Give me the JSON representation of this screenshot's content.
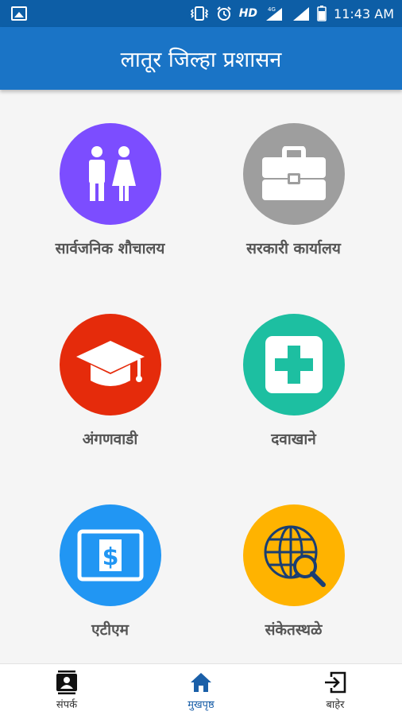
{
  "status_bar": {
    "network_type": "HD",
    "network_gen": "4G",
    "time": "11:43 AM"
  },
  "app_bar": {
    "title": "लातूर जिल्हा प्रशासन"
  },
  "tiles": [
    {
      "label": "सार्वजनिक शौचालय",
      "icon": "restroom-icon",
      "color": "#7c4dff"
    },
    {
      "label": "सरकारी कार्यालय",
      "icon": "briefcase-icon",
      "color": "#9e9e9e"
    },
    {
      "label": "अंगणवाडी",
      "icon": "graduation-cap-icon",
      "color": "#e52b0b"
    },
    {
      "label": "दवाखाने",
      "icon": "medical-cross-icon",
      "color": "#1dbfa1"
    },
    {
      "label": "एटीएम",
      "icon": "atm-icon",
      "color": "#2196f3"
    },
    {
      "label": "संकेतस्थळे",
      "icon": "web-search-icon",
      "color": "#ffb300"
    }
  ],
  "bottom_nav": {
    "items": [
      {
        "label": "संपर्क",
        "icon": "contacts-icon",
        "active": false
      },
      {
        "label": "मुखपृष्ठ",
        "icon": "home-icon",
        "active": true
      },
      {
        "label": "बाहेर",
        "icon": "exit-icon",
        "active": false
      }
    ],
    "active_color": "#1a5fa8"
  }
}
